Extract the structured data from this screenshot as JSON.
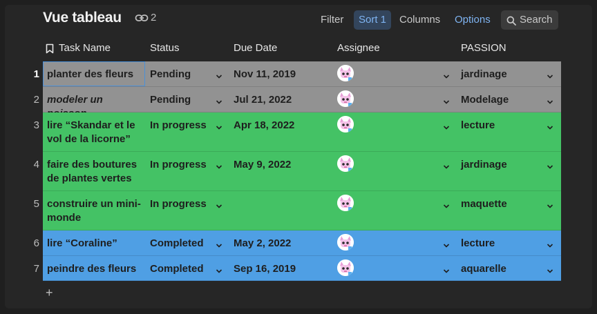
{
  "header": {
    "title": "Vue tableau",
    "link_icon": "link-icon",
    "link_count": "2"
  },
  "toolbar": {
    "filter_label": "Filter",
    "sort_label": "Sort 1",
    "columns_label": "Columns",
    "options_label": "Options",
    "search_label": "Search",
    "accent": "#7fb4f2"
  },
  "columns": {
    "task_name": "Task Name",
    "status": "Status",
    "due_date": "Due Date",
    "assignee": "Assignee",
    "passion": "PASSION"
  },
  "rows": [
    {
      "num": "1",
      "name": "planter des fleurs",
      "status": "Pending",
      "due": "Nov 11, 2019",
      "passion": "jardinage"
    },
    {
      "num": "2",
      "name": "modeler un poisson",
      "status": "Pending",
      "due": "Jul 21, 2022",
      "passion": "Modelage"
    },
    {
      "num": "3",
      "name": "lire “Skandar et le vol de la licorne”",
      "status": "In progress",
      "due": "Apr 18, 2022",
      "passion": "lecture"
    },
    {
      "num": "4",
      "name": "faire des boutures de plantes vertes",
      "status": "In progress",
      "due": "May 9, 2022",
      "passion": "jardinage"
    },
    {
      "num": "5",
      "name": "construire un mini-monde",
      "status": "In progress",
      "due": "",
      "passion": "maquette"
    },
    {
      "num": "6",
      "name": "lire “Coraline”",
      "status": "Completed",
      "due": "May 2, 2022",
      "passion": "lecture"
    },
    {
      "num": "7",
      "name": "peindre des fleurs",
      "status": "Completed",
      "due": "Sep 16, 2019",
      "passion": "aquarelle"
    }
  ],
  "row_colors": {
    "Pending": "#929292",
    "In progress": "#44c265",
    "Completed": "#4f9fe4"
  },
  "add_row_label": "+"
}
